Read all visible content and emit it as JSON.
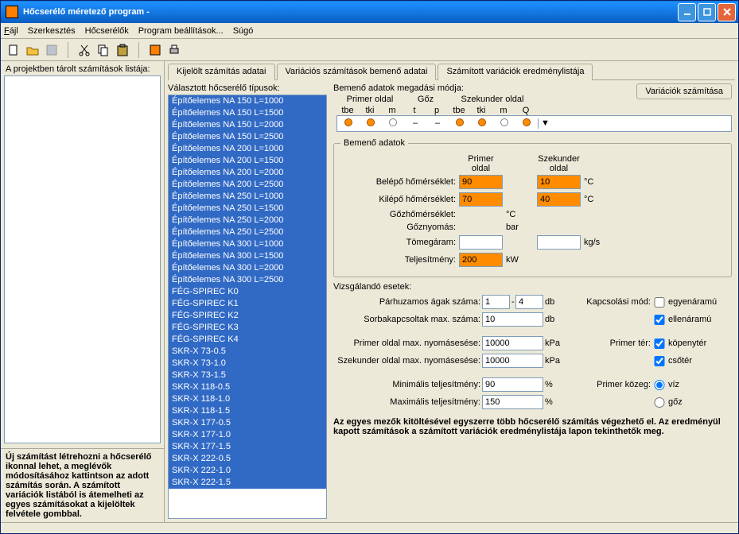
{
  "window": {
    "title": "Hőcserélő méretező program -"
  },
  "menu": {
    "file": "Fájl",
    "edit": "Szerkesztés",
    "hx": "Hőcserélők",
    "settings": "Program beállítások...",
    "help": "Súgó"
  },
  "left": {
    "label": "A projektben tárolt számítások listája:",
    "hint": "Új számítást létrehozni a hőcserélő ikonnal lehet, a meglévők módosításához kattintson az adott számítás során. A számított variációk listából is átemelheti az egyes számításokat a kijelöltek felvétele gombbal."
  },
  "tabs": {
    "t1": "Kijelölt számítás adatai",
    "t2": "Variációs számítások bemenő adatai",
    "t3": "Számított variációk eredménylistája"
  },
  "types": {
    "label": "Választott hőcserélő típusok:",
    "items": [
      "Építőelemes NA 150 L=1000",
      "Építőelemes NA 150 L=1500",
      "Építőelemes NA 150 L=2000",
      "Építőelemes NA 150 L=2500",
      "Építőelemes NA 200 L=1000",
      "Építőelemes NA 200 L=1500",
      "Építőelemes NA 200 L=2000",
      "Építőelemes NA 200 L=2500",
      "Építőelemes NA 250 L=1000",
      "Építőelemes NA 250 L=1500",
      "Építőelemes NA 250 L=2000",
      "Építőelemes NA 250 L=2500",
      "Építőelemes NA 300 L=1000",
      "Építőelemes NA 300 L=1500",
      "Építőelemes NA 300 L=2000",
      "Építőelemes NA 300 L=2500",
      "FÉG-SPIREC K0",
      "FÉG-SPIREC K1",
      "FÉG-SPIREC K2",
      "FÉG-SPIREC K3",
      "FÉG-SPIREC K4",
      "SKR-X 73-0.5",
      "SKR-X 73-1.0",
      "SKR-X 73-1.5",
      "SKR-X 118-0.5",
      "SKR-X 118-1.0",
      "SKR-X 118-1.5",
      "SKR-X 177-0.5",
      "SKR-X 177-1.0",
      "SKR-X 177-1.5",
      "SKR-X 222-0.5",
      "SKR-X 222-1.0",
      "SKR-X 222-1.5"
    ]
  },
  "form": {
    "calc_button": "Variációk számítása",
    "input_mode_label": "Bemenő adatok megadási módja:",
    "primer_side": "Primer oldal",
    "goz": "Gőz",
    "sec_side": "Szekunder oldal",
    "h_tbe": "tbe",
    "h_tki": "tki",
    "h_m": "m",
    "h_t": "t",
    "h_p": "p",
    "h_Q": "Q",
    "group_title": "Bemenő adatok",
    "col_primer": "Primer oldal",
    "col_sec": "Szekunder oldal",
    "belepo": "Belépő hőmérséklet:",
    "kilepo": "Kilépő hőmérséklet:",
    "gozhom": "Gőzhőmérséklet:",
    "goznyom": "Gőznyomás:",
    "tomeg": "Tömegáram:",
    "telj": "Teljesítmény:",
    "u_c": "°C",
    "u_bar": "bar",
    "u_kgs": "kg/s",
    "u_kw": "kW",
    "v_belepo_p": "90",
    "v_belepo_s": "10",
    "v_kilepo_p": "70",
    "v_kilepo_s": "40",
    "v_telj": "200",
    "vizsg_label": "Vizsgálandó esetek:",
    "parhuz": "Párhuzamos ágak száma:",
    "parhuz_a": "1",
    "parhuz_b": "4",
    "parhuz_u": "db",
    "sorba": "Sorbakapcsoltak max. száma:",
    "sorba_v": "10",
    "sorba_u": "db",
    "pmax": "Primer oldal max. nyomásesése:",
    "pmax_v": "10000",
    "pmax_u": "kPa",
    "smax": "Szekunder oldal max. nyomásesése:",
    "smax_v": "10000",
    "smax_u": "kPa",
    "min_t": "Minimális teljesítmény:",
    "min_t_v": "90",
    "pct": "%",
    "max_t": "Maximális teljesítmény:",
    "max_t_v": "150",
    "kapcs_mod": "Kapcsolási mód:",
    "egyen": "egyenáramú",
    "ellen": "ellenáramú",
    "primer_ter": "Primer tér:",
    "kopeny": "köpenytér",
    "csoter": "csőtér",
    "primer_koz": "Primer közeg:",
    "viz": "víz",
    "goz_r": "gőz",
    "bottom": "Az egyes mezők kitöltésével egyszerre több hőcserélő számítás végezhető el. Az eredményül kapott számítások a számított variációk eredménylistája lapon tekinthetők meg."
  }
}
